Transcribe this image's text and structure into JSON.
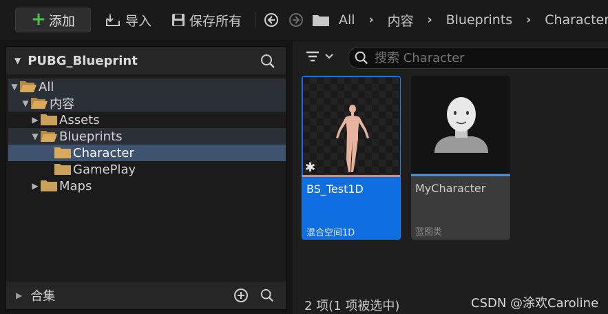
{
  "toolbar": {
    "add_label": "添加",
    "import_label": "导入",
    "save_all_label": "保存所有",
    "breadcrumb": [
      "All",
      "内容",
      "Blueprints",
      "Character"
    ]
  },
  "left_panel": {
    "title": "PUBG_Blueprint",
    "tree": [
      {
        "label": "All",
        "level": 0,
        "expanded": true
      },
      {
        "label": "内容",
        "level": 1,
        "expanded": true
      },
      {
        "label": "Assets",
        "level": 2,
        "expanded": false
      },
      {
        "label": "Blueprints",
        "level": 2,
        "expanded": true
      },
      {
        "label": "Character",
        "level": 3,
        "selected": true
      },
      {
        "label": "GamePlay",
        "level": 3
      },
      {
        "label": "Maps",
        "level": 2,
        "expanded": false
      }
    ],
    "collections_label": "合集"
  },
  "right_panel": {
    "search_placeholder": "搜索 Character",
    "assets": [
      {
        "name": "BS_Test1D",
        "type": "混合空间1D",
        "selected": true,
        "type_color": "#e08a6a"
      },
      {
        "name": "MyCharacter",
        "type": "蓝图类",
        "selected": false,
        "type_color": "#3f8ee8"
      }
    ],
    "status": "2 项(1 项被选中)"
  },
  "watermark": "CSDN @涂欢Caroline",
  "colors": {
    "selection_blue": "#0f6fe0",
    "tree_selected": "#3e5370",
    "add_green": "#4cc24c",
    "folder": "#c9a15a"
  }
}
